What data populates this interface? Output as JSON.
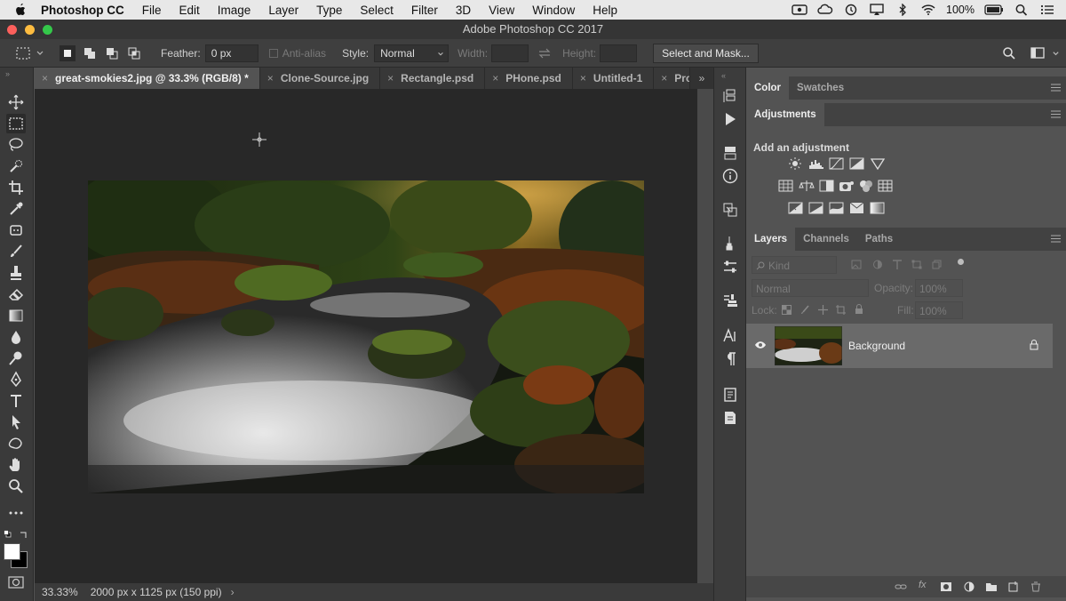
{
  "menubar": {
    "app": "Photoshop CC",
    "items": [
      "File",
      "Edit",
      "Image",
      "Layer",
      "Type",
      "Select",
      "Filter",
      "3D",
      "View",
      "Window",
      "Help"
    ],
    "battery": "100%"
  },
  "window": {
    "title": "Adobe Photoshop CC 2017"
  },
  "options": {
    "feather_label": "Feather:",
    "feather_value": "0 px",
    "antialias_label": "Anti-alias",
    "style_label": "Style:",
    "style_value": "Normal",
    "width_label": "Width:",
    "height_label": "Height:",
    "select_mask_label": "Select and Mask..."
  },
  "tabs": [
    {
      "label": "great-smokies2.jpg @ 33.3% (RGB/8) *"
    },
    {
      "label": "Clone-Source.jpg"
    },
    {
      "label": "Rectangle.psd"
    },
    {
      "label": "PHone.psd"
    },
    {
      "label": "Untitled-1"
    },
    {
      "label": "Prc"
    }
  ],
  "status": {
    "zoom": "33.33%",
    "info": "2000 px x 1125 px (150 ppi)"
  },
  "panels": {
    "color_tabs": [
      "Color",
      "Swatches"
    ],
    "adjustments_tab": "Adjustments",
    "add_adjustment": "Add an adjustment",
    "layer_tabs": [
      "Layers",
      "Channels",
      "Paths"
    ],
    "kind_label": "Kind",
    "blend_mode": "Normal",
    "opacity_label": "Opacity:",
    "opacity_value": "100%",
    "lock_label": "Lock:",
    "fill_label": "Fill:",
    "fill_value": "100%",
    "layer_name": "Background"
  },
  "icons": {
    "toolbar": [
      "move-icon",
      "marquee-icon",
      "lasso-icon",
      "quick-select-icon",
      "crop-icon",
      "eyedropper-icon",
      "healing-icon",
      "brush-icon",
      "stamp-icon",
      "eraser-icon",
      "gradient-icon",
      "blur-icon",
      "dodge-icon",
      "pen-icon",
      "type-icon",
      "path-select-icon",
      "shape-icon",
      "hand-icon",
      "zoom-icon",
      "more-tools-icon"
    ]
  },
  "colors": {
    "accent_active_tab": "#535353",
    "canvas_bg": "#282828",
    "panel_bg": "#535353"
  }
}
